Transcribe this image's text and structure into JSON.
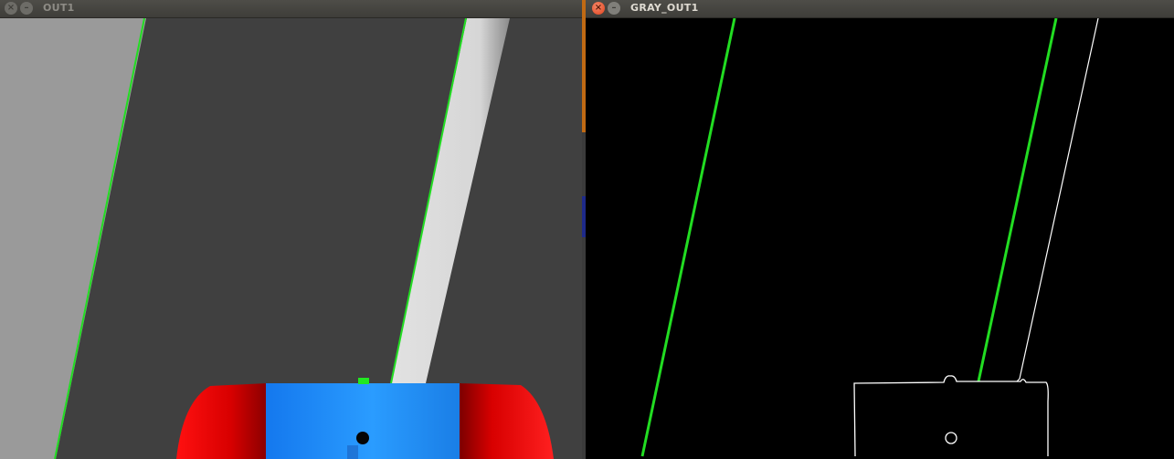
{
  "windows": {
    "left": {
      "title": "OUT1",
      "close_icon": "close-icon",
      "minimize_icon": "minimize-icon"
    },
    "right": {
      "title": "GRAY_OUT1",
      "close_icon": "close-icon",
      "minimize_icon": "minimize-icon"
    }
  },
  "colors": {
    "road": "#404040",
    "offroad": "#9a9a9a",
    "lane_marking": "#dcdcdc",
    "detected_line": "#22dd22",
    "robot_body": "#1f8cf0",
    "robot_wheels": "#e00000",
    "edge_background": "#000000",
    "edge_outline": "#ffffff"
  }
}
